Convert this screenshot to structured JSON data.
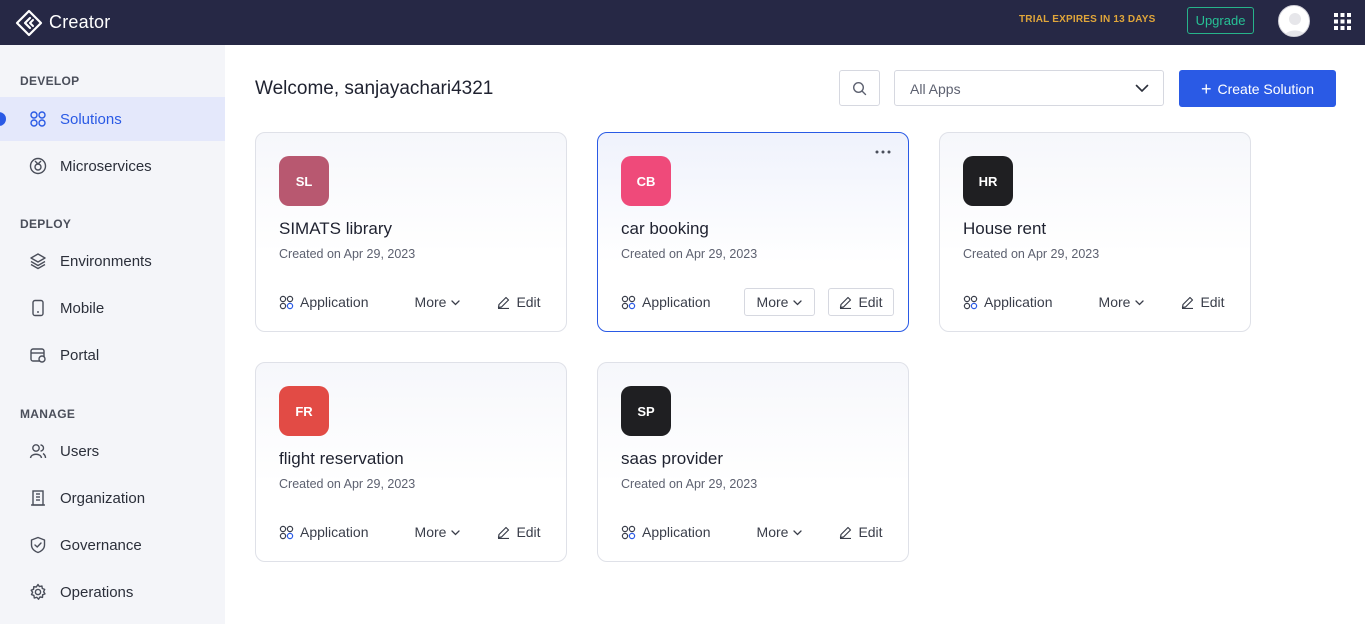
{
  "header": {
    "app_name": "Creator",
    "trial_text": "TRIAL EXPIRES IN 13 DAYS",
    "upgrade_label": "Upgrade",
    "colors": {
      "bar": "#262845",
      "trial": "#e0a63a",
      "upgrade": "#27c095"
    }
  },
  "sidebar": {
    "sections": [
      {
        "title": "DEVELOP",
        "items": [
          {
            "label": "Solutions",
            "icon": "grid-circles-icon",
            "active": true
          },
          {
            "label": "Microservices",
            "icon": "microservices-icon"
          }
        ]
      },
      {
        "title": "DEPLOY",
        "items": [
          {
            "label": "Environments",
            "icon": "layers-icon"
          },
          {
            "label": "Mobile",
            "icon": "mobile-icon"
          },
          {
            "label": "Portal",
            "icon": "portal-icon"
          }
        ]
      },
      {
        "title": "MANAGE",
        "items": [
          {
            "label": "Users",
            "icon": "users-icon"
          },
          {
            "label": "Organization",
            "icon": "building-icon"
          },
          {
            "label": "Governance",
            "icon": "shield-icon"
          },
          {
            "label": "Operations",
            "icon": "gear-icon"
          }
        ]
      }
    ]
  },
  "main": {
    "welcome": "Welcome, sanjayachari4321",
    "filter": {
      "selected": "All Apps"
    },
    "create_label": "Create Solution",
    "accent": "#2a5ae5",
    "cards": [
      {
        "initials": "SL",
        "name": "SIMATS library",
        "created": "Created on Apr 29, 2023",
        "type": "Application",
        "more": "More",
        "edit": "Edit",
        "color": "#b85870"
      },
      {
        "initials": "CB",
        "name": "car booking",
        "created": "Created on Apr 29, 2023",
        "type": "Application",
        "more": "More",
        "edit": "Edit",
        "color": "#ef4a7a",
        "hovered": true
      },
      {
        "initials": "HR",
        "name": "House rent",
        "created": "Created on Apr 29, 2023",
        "type": "Application",
        "more": "More",
        "edit": "Edit",
        "color": "#1f1f22"
      },
      {
        "initials": "FR",
        "name": "flight reservation",
        "created": "Created on Apr 29, 2023",
        "type": "Application",
        "more": "More",
        "edit": "Edit",
        "color": "#e24b45"
      },
      {
        "initials": "SP",
        "name": "saas provider",
        "created": "Created on Apr 29, 2023",
        "type": "Application",
        "more": "More",
        "edit": "Edit",
        "color": "#1f1f22"
      }
    ]
  }
}
